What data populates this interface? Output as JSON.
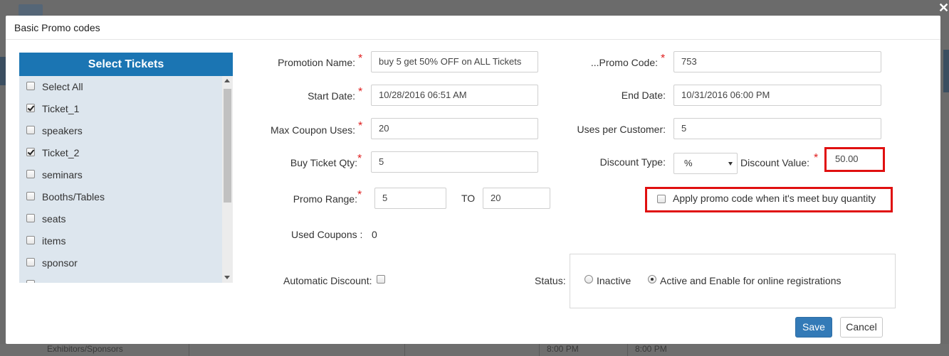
{
  "dialog": {
    "title": "Basic Promo codes"
  },
  "tickets": {
    "header": "Select Tickets",
    "items": [
      {
        "label": "Select All",
        "checked": false
      },
      {
        "label": "Ticket_1",
        "checked": true
      },
      {
        "label": "speakers",
        "checked": false
      },
      {
        "label": "Ticket_2",
        "checked": true
      },
      {
        "label": "seminars",
        "checked": false
      },
      {
        "label": "Booths/Tables",
        "checked": false
      },
      {
        "label": "seats",
        "checked": false
      },
      {
        "label": "items",
        "checked": false
      },
      {
        "label": "sponsor",
        "checked": false
      }
    ]
  },
  "form": {
    "promotion_name": {
      "label": "Promotion Name:",
      "value": "buy 5 get 50% OFF on ALL Tickets"
    },
    "promo_code": {
      "label": "...Promo Code:",
      "value": "753"
    },
    "start_date": {
      "label": "Start Date:",
      "value": "10/28/2016 06:51 AM"
    },
    "end_date": {
      "label": "End Date:",
      "value": "10/31/2016 06:00 PM"
    },
    "max_coupon_uses": {
      "label": "Max Coupon Uses:",
      "value": "20"
    },
    "uses_per_customer": {
      "label": "Uses per Customer:",
      "value": "5"
    },
    "buy_ticket_qty": {
      "label": "Buy Ticket Qty:",
      "value": "5"
    },
    "discount_type": {
      "label": "Discount Type:",
      "value": "%"
    },
    "discount_value": {
      "label": "Discount Value:",
      "value": "50.00"
    },
    "promo_range": {
      "label": "Promo Range:",
      "from": "5",
      "to_label": "TO",
      "to": "20"
    },
    "apply_promo": {
      "label": "Apply promo code when it's meet buy quantity",
      "checked": false
    },
    "used_coupons": {
      "label": "Used Coupons :",
      "value": "0"
    },
    "automatic_discount": {
      "label": "Automatic Discount:",
      "checked": false
    },
    "status": {
      "label": "Status:",
      "options": [
        {
          "label": "Inactive",
          "selected": false
        },
        {
          "label": "Active and Enable for online registrations",
          "selected": true
        }
      ]
    },
    "required_mark": "*"
  },
  "buttons": {
    "save": "Save",
    "cancel": "Cancel"
  },
  "background": {
    "row_text_1": "8:00 PM",
    "row_text_2": "8:00 PM",
    "row_text_3": "Exhibitors/Sponsors"
  },
  "colors": {
    "primary": "#337ab7",
    "ticket_header": "#1b75b3",
    "highlight": "#e01010",
    "required": "#e02020"
  }
}
